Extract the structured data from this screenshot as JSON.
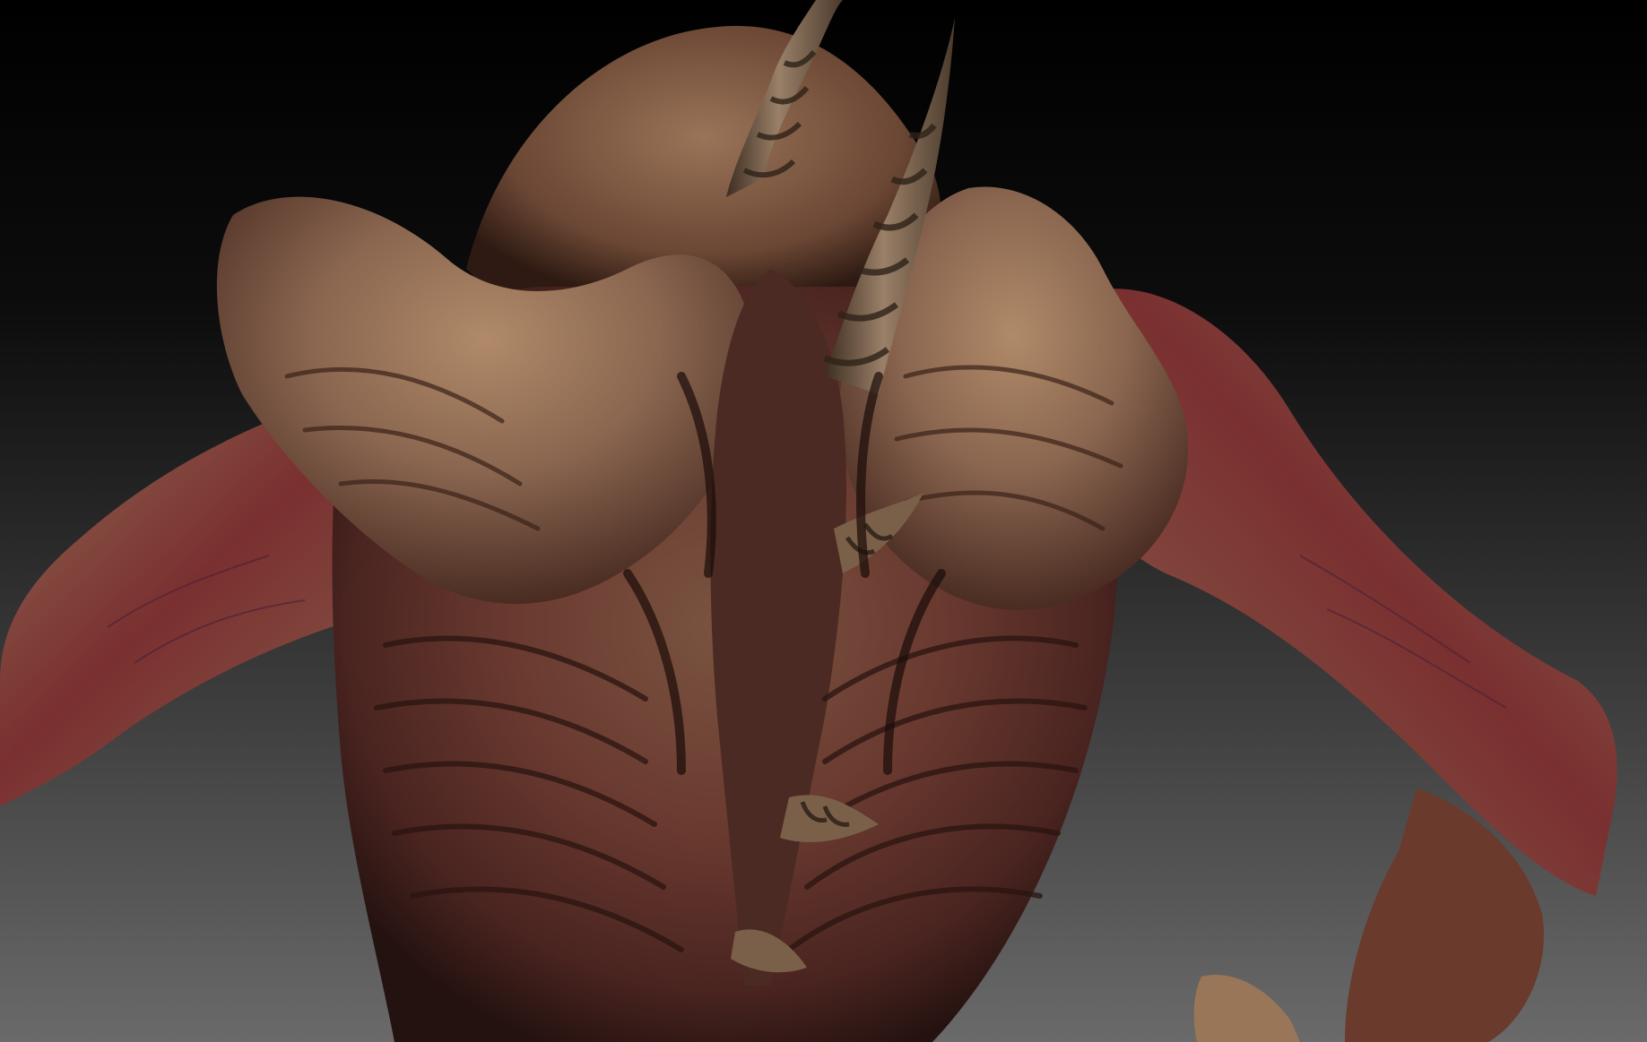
{
  "scene": {
    "subject": "creature-sculpt-back-view",
    "colors": {
      "skin_tan": "#8a6a50",
      "skin_light": "#a88564",
      "muscle_red": "#6e2a2a",
      "muscle_dark": "#3e1a18",
      "horn": "#7d6650",
      "horn_dark": "#4a3a2c",
      "shadow": "#1a0e0a",
      "background_top": "#000000",
      "background_bottom": "#6a6a6a"
    }
  }
}
